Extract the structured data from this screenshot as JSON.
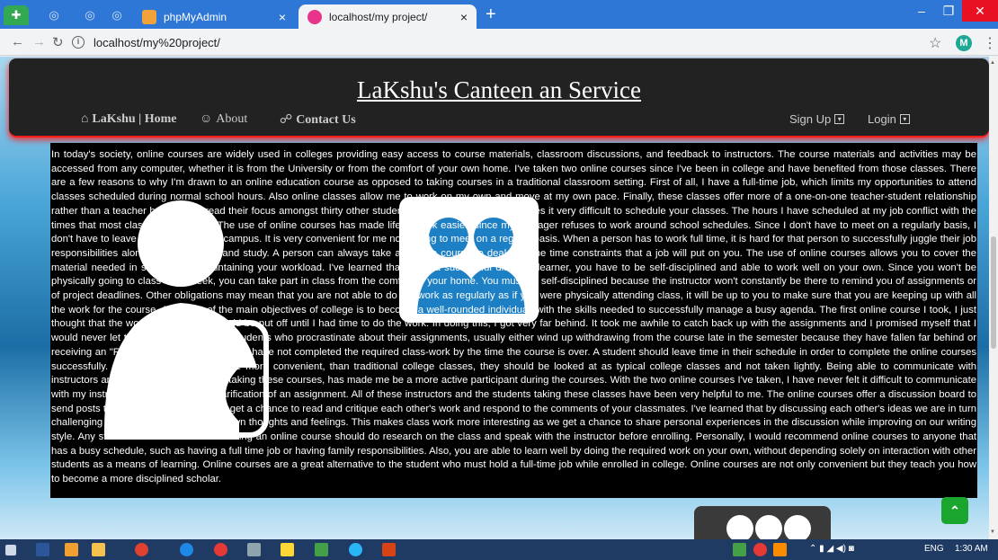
{
  "browser": {
    "tabs": [
      {
        "title": "phpMyAdmin",
        "active": false
      },
      {
        "title": "localhost/my project/",
        "active": true
      }
    ],
    "tab_close_glyph": "×",
    "new_tab_glyph": "+",
    "address": "localhost/my%20project/",
    "profile_initial": "M",
    "window_buttons": [
      "–",
      "❐",
      "✕"
    ]
  },
  "site": {
    "title": "LaKshu's Canteen an Service",
    "nav": {
      "home": "LaKshu | Home",
      "about": "About",
      "contact": "Contact Us",
      "signup": "Sign Up",
      "login": "Login"
    },
    "article": "In today's society, online courses are widely used in colleges providing easy access to course materials, classroom discussions, and feedback to instructors. The course materials and activities may be accessed from any computer, whether it is from the University or from the comfort of your own home. I've taken two online courses since I've been in college and have benefited from those classes. There are a few reasons to why I'm drawn to an online education course as opposed to taking courses in a traditional classroom setting. First of all, I have a full-time job, which limits my opportunities to attend classes scheduled during normal school hours. Also online classes allow me to work on my own and move at my own pace. Finally, these classes offer more of a one-on-one teacher-student relationship rather than a teacher having to spread their focus amongst thirty other students. Having a full time job makes it very difficult to schedule your classes. The hours I have scheduled at my job conflict with the times that most classes are offered. The use of online courses has made life at work easier, since my manager refuses to work around school schedules. Since I don't have to meet on a regularly basis, I don't have to leave my job to meet on campus. It is very convenient for me not having to meet on a regular basis. When a person has to work full time, it is hard for that person to successfully juggle their job responsibilities along with homework and study. A person can always take an online course to deal with the time constraints that a job will put on you. The use of online courses allows you to cover the material needed in school while maintaining your workload. I've learned that to be a successful distance learner, you have to be self-disciplined and able to work well on your own. Since you won't be physically going to class each week, you can take part in class from the comfort of your home. You must be self-disciplined because the instructor won't constantly be there to remind you of assignments or of project deadlines. Other obligations may mean that you are not able to do the work as regularly as if you were physically attending class, it will be up to you to make sure that you are keeping up with all the work for the course. Also, one of the main objectives of college is to become a well-rounded individual, with the skills needed to successfully manage a busy agenda. The first online course I took, I just thought that the work for the course could be put off until I had time to do the work. In doing this, I got very far behind. It took me awhile to catch back up with the assignments and I promised myself that I would never let that happen again. The students who procrastinate about their assignments, usually either wind up withdrawing from the course late in the semester because they have fallen far behind or receiving an \"F\" in the course because they have not completed the required class-work by the time the course is over. A student should leave time in their schedule in order to complete the online courses successfully. Although online classes are more convenient, than traditional college classes, they should be looked at as typical college classes and not taken lightly. Being able to communicate with instructors and other students, that are taking these courses, has made me be a more active participant during the courses. With the two online courses I've taken, I have never felt it difficult to communicate with my instructor to ask for help or clarification of an assignment. All of these instructors and the students taking these classes have been very helpful to me. The online courses offer a discussion board to send posts to your fellow students. You get a chance to read and critique each other's work and respond to the comments of your classmates. I've learned that by discussing each other's ideas we are in turn challenging each other to examine our own thoughts and feelings. This makes class work more interesting as we get a chance to share personal experiences in the discussion while improving on our writing style. Any student that is interested in taking an online course should do research on the class and speak with the instructor before enrolling. Personally, I would recommend online courses to anyone that has a busy schedule, such as having a full time job or having family responsibilities. Also, you are able to learn well by doing the required work on your own, without depending solely on interaction with other students as a means of learning. Online courses are a great alternative to the student who must hold a full-time job while enrolled in college. Online courses are not only convenient but they teach you how to become a more disciplined scholar."
  },
  "taskbar": {
    "language": "ENG",
    "time": "1:30 AM"
  },
  "colors": {
    "tabstrip": "#2f77d6",
    "header_bg": "#222222",
    "header_glow": "#ff1a1a",
    "back_to_top": "#1aa52f"
  }
}
